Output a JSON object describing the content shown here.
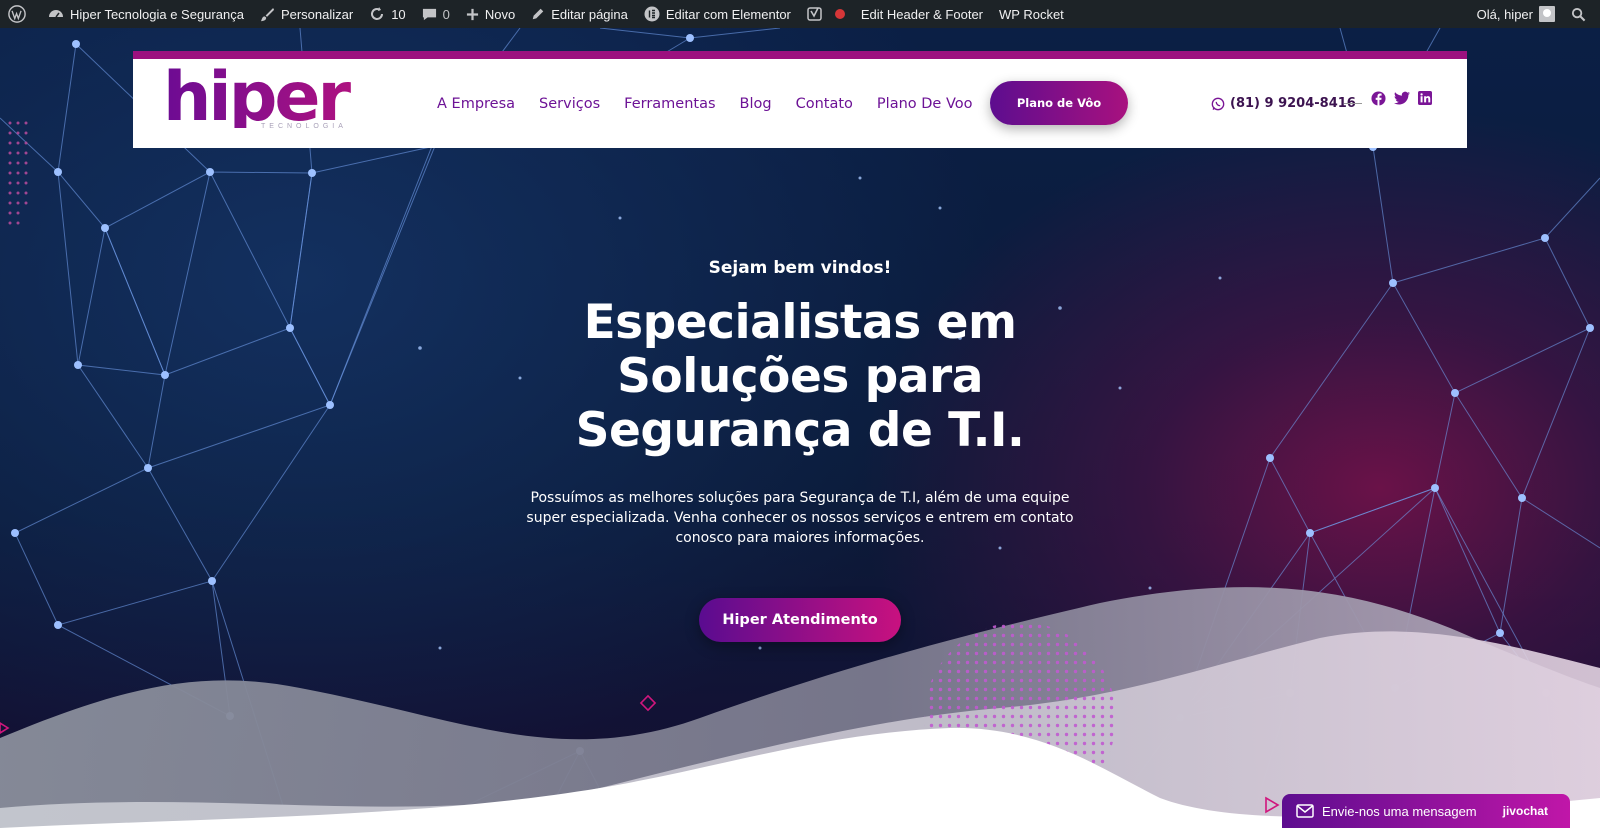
{
  "admin_bar": {
    "site_name": "Hiper Tecnologia e Segurança",
    "customize": "Personalizar",
    "updates_count": "10",
    "comments_count": "0",
    "new": "Novo",
    "edit_page": "Editar página",
    "edit_elementor": "Editar com Elementor",
    "edit_header_footer": "Edit Header & Footer",
    "wp_rocket": "WP Rocket",
    "greeting": "Olá, hiper"
  },
  "header": {
    "logo_text": "hiper",
    "logo_subtext": "TECNOLOGIA",
    "nav": [
      "A Empresa",
      "Serviços",
      "Ferramentas",
      "Blog",
      "Contato",
      "Plano De Voo"
    ],
    "cta_label": "Plano de Vôo",
    "phone": "(81) 9 9204-8416",
    "social": [
      "facebook-icon",
      "twitter-icon",
      "linkedin-icon"
    ]
  },
  "hero": {
    "welcome": "Sejam bem vindos!",
    "headline": "Especialistas em Soluções para Segurança de T.I.",
    "description": "Possuímos as melhores soluções para Segurança de T.I, além de uma equipe super especializada. Venha conhecer os nossos serviços e entrem em contato conosco para maiores informações.",
    "button_label": "Hiper Atendimento"
  },
  "chat": {
    "label": "Envie-nos uma mensagem",
    "brand": "jivochat"
  },
  "colors": {
    "admin_bar_bg": "#1d2327",
    "brand_purple": "#6d1396",
    "brand_magenta": "#b2127f",
    "hero_bg": "#0b1f45"
  }
}
